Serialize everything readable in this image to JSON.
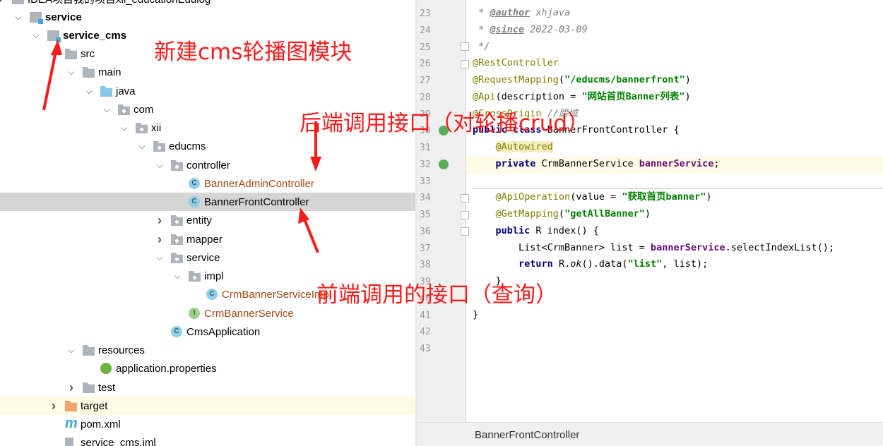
{
  "project_tree": {
    "items": [
      {
        "label": "IDEA项目我的项目xii_educationEdulog",
        "level": -1,
        "icon": "folder-icon",
        "expand": "collapsed"
      },
      {
        "label": "service",
        "level": 0,
        "icon": "module-folder-icon",
        "expand": "expanded",
        "bold": true
      },
      {
        "label": "service_cms",
        "level": 1,
        "icon": "module-folder-icon",
        "expand": "expanded",
        "bold": true
      },
      {
        "label": "src",
        "level": 2,
        "icon": "folder-icon",
        "expand": "expanded"
      },
      {
        "label": "main",
        "level": 3,
        "icon": "folder-icon",
        "expand": "expanded"
      },
      {
        "label": "java",
        "level": 4,
        "icon": "source-folder-icon",
        "expand": "expanded"
      },
      {
        "label": "com",
        "level": 5,
        "icon": "package-icon",
        "expand": "expanded"
      },
      {
        "label": "xii",
        "level": 6,
        "icon": "package-icon",
        "expand": "expanded"
      },
      {
        "label": "educms",
        "level": 7,
        "icon": "package-icon",
        "expand": "expanded"
      },
      {
        "label": "controller",
        "level": 8,
        "icon": "package-icon",
        "expand": "expanded"
      },
      {
        "label": "BannerAdminController",
        "level": 9,
        "icon": "class-icon",
        "expand": "none",
        "modified": true
      },
      {
        "label": "BannerFrontController",
        "level": 9,
        "icon": "class-icon",
        "expand": "none",
        "selected": true
      },
      {
        "label": "entity",
        "level": 8,
        "icon": "package-icon",
        "expand": "collapsed"
      },
      {
        "label": "mapper",
        "level": 8,
        "icon": "package-icon",
        "expand": "collapsed"
      },
      {
        "label": "service",
        "level": 8,
        "icon": "package-icon",
        "expand": "expanded"
      },
      {
        "label": "impl",
        "level": 9,
        "icon": "package-icon",
        "expand": "expanded"
      },
      {
        "label": "CrmBannerServiceImpl",
        "level": 10,
        "icon": "class-icon",
        "expand": "none",
        "modified": true
      },
      {
        "label": "CrmBannerService",
        "level": 9,
        "icon": "interface-icon",
        "expand": "none",
        "modified": true
      },
      {
        "label": "CmsApplication",
        "level": 8,
        "icon": "spring-boot-class-icon",
        "expand": "none"
      },
      {
        "label": "resources",
        "level": 3,
        "icon": "resources-folder-icon",
        "expand": "expanded"
      },
      {
        "label": "application.properties",
        "level": 4,
        "icon": "spring-properties-icon",
        "expand": "none"
      },
      {
        "label": "test",
        "level": 3,
        "icon": "folder-icon",
        "expand": "collapsed"
      },
      {
        "label": "target",
        "level": 2,
        "icon": "excluded-folder-icon",
        "expand": "collapsed",
        "highlighted": true
      },
      {
        "label": "pom.xml",
        "level": 2,
        "icon": "maven-icon",
        "expand": "none"
      },
      {
        "label": "service_cms.iml",
        "level": 2,
        "icon": "file-icon",
        "expand": "none"
      }
    ]
  },
  "editor": {
    "lines": [
      {
        "n": "23",
        "html": "<span class='cm'> * <span class='tag'>@author</span> xhjava</span>"
      },
      {
        "n": "24",
        "html": "<span class='cm'> * <span class='tag'>@since</span> 2022-03-09</span>"
      },
      {
        "n": "25",
        "html": "<span class='cm'> */</span>"
      },
      {
        "n": "26",
        "html": "<span class='ann'>@RestController</span>"
      },
      {
        "n": "27",
        "html": "<span class='ann'>@RequestMapping</span>(<span class='str'>\"/educms/bannerfront\"</span>)"
      },
      {
        "n": "28",
        "html": "<span class='ann'>@Api</span>(description = <span class='str'>\"网站首页Banner列表\"</span>)"
      },
      {
        "n": "29",
        "html": "<span class='ann'>@CrossOrigin</span> <span class='cm'>//跨域</span>"
      },
      {
        "n": "30",
        "html": "<span class='kw'>public class</span> BannerFrontController {"
      },
      {
        "n": "31",
        "html": "    <span class='ann' style='background:#f5eec0'>@Autowired</span>"
      },
      {
        "n": "32",
        "html": "    <span class='kw'>private</span> CrmBannerService <span class='fld'>bannerService</span>;"
      },
      {
        "n": "33",
        "html": ""
      },
      {
        "n": "34",
        "html": "    <span class='ann'>@ApiOperation</span>(value = <span class='str'>\"获取首页banner\"</span>)"
      },
      {
        "n": "35",
        "html": "    <span class='ann'>@GetMapping</span>(<span class='str'>\"getAllBanner\"</span>)"
      },
      {
        "n": "36",
        "html": "    <span class='kw'>public</span> R index() {"
      },
      {
        "n": "37",
        "html": "        List&lt;CrmBanner&gt; list = <span class='fld'>bannerService</span>.selectIndexList();"
      },
      {
        "n": "38",
        "html": "        <span class='kw'>return</span> R.<i>ok</i>().data(<span class='str'>\"list\"</span>, list);"
      },
      {
        "n": "39",
        "html": "    }"
      },
      {
        "n": "40",
        "html": ""
      },
      {
        "n": "41",
        "html": "}"
      },
      {
        "n": "42",
        "html": ""
      },
      {
        "n": "43",
        "html": ""
      }
    ],
    "breadcrumb": "BannerFrontController"
  },
  "annotations": {
    "new_module": "新建cms轮播图模块",
    "backend_api": "后端调用接口（对轮播crud）",
    "frontend_api": "前端调用的接口（查询）",
    "color": "#ff1a1a"
  }
}
